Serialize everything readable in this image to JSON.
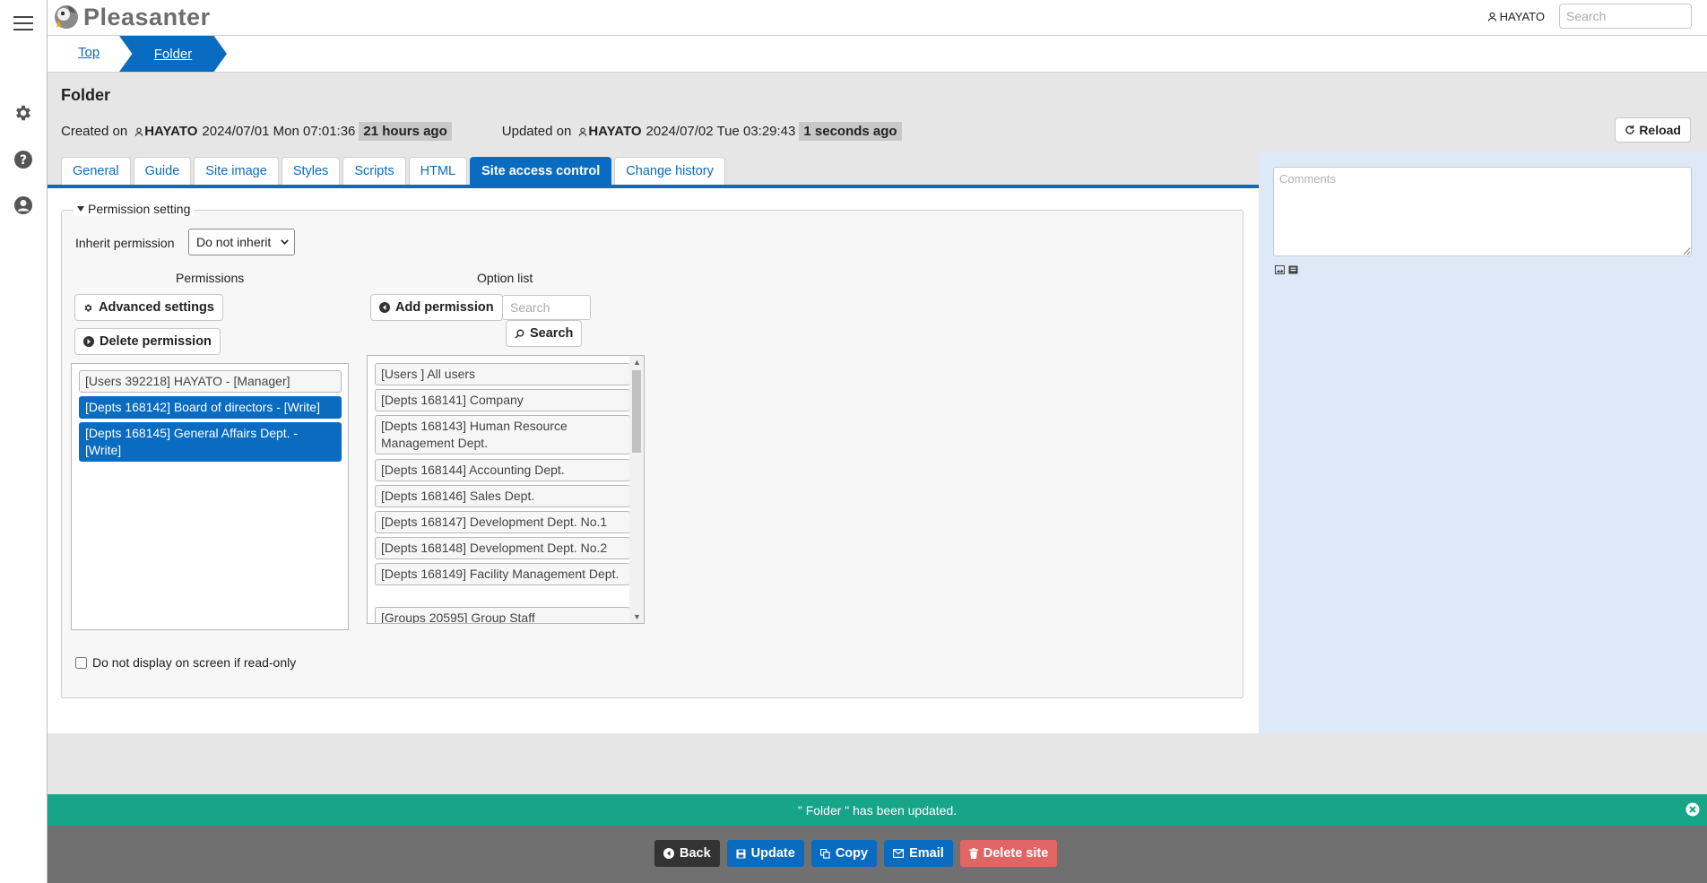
{
  "header": {
    "app_name": "Pleasanter",
    "user_name": "HAYATO",
    "search_placeholder": "Search"
  },
  "breadcrumb": {
    "items": [
      {
        "label": "Top"
      },
      {
        "label": "Folder"
      }
    ]
  },
  "page": {
    "title": "Folder",
    "created_label": "Created on",
    "created_user": "HAYATO",
    "created_datetime": "2024/07/01 Mon 07:01:36",
    "created_ago": "21 hours ago",
    "updated_label": "Updated on",
    "updated_user": "HAYATO",
    "updated_datetime": "2024/07/02 Tue 03:29:43",
    "updated_ago": "1 seconds ago",
    "reload_label": "Reload"
  },
  "tabs": [
    {
      "label": "General"
    },
    {
      "label": "Guide"
    },
    {
      "label": "Site image"
    },
    {
      "label": "Styles"
    },
    {
      "label": "Scripts"
    },
    {
      "label": "HTML"
    },
    {
      "label": "Site access control",
      "active": true
    },
    {
      "label": "Change history"
    }
  ],
  "comments": {
    "placeholder": "Comments"
  },
  "permission": {
    "legend": "Permission setting",
    "inherit_label": "Inherit permission",
    "inherit_value": "Do not inherit",
    "permissions_heading": "Permissions",
    "option_list_heading": "Option list",
    "advanced_settings_label": "Advanced settings",
    "delete_permission_label": "Delete permission",
    "add_permission_label": "Add permission",
    "search_placeholder": "Search",
    "search_button_label": "Search",
    "current": [
      {
        "text": "[Users 392218] HAYATO - [Manager]",
        "selected": false
      },
      {
        "text": "[Depts 168142] Board of directors - [Write]",
        "selected": true
      },
      {
        "text": "[Depts 168145] General Affairs Dept. - [Write]",
        "selected": true
      }
    ],
    "options": [
      {
        "text": "[Users ] All users"
      },
      {
        "text": "[Depts 168141] Company"
      },
      {
        "text": "[Depts 168143] Human Resource Management Dept."
      },
      {
        "text": "[Depts 168144] Accounting Dept."
      },
      {
        "text": "[Depts 168146] Sales Dept."
      },
      {
        "text": "[Depts 168147] Development Dept. No.1"
      },
      {
        "text": "[Depts 168148] Development Dept. No.2"
      },
      {
        "text": "[Depts 168149] Facility Management Dept."
      },
      {
        "text": "[Groups 20595] Group Staff"
      }
    ],
    "readonly_checkbox_label": "Do not display on screen if read-only"
  },
  "message": {
    "text": "\" Folder \" has been updated."
  },
  "footer": {
    "back_label": "Back",
    "update_label": "Update",
    "copy_label": "Copy",
    "email_label": "Email",
    "delete_label": "Delete site"
  },
  "colors": {
    "primary": "#0a6cc0",
    "success": "#17a589",
    "danger": "#e06666",
    "dark": "#333333"
  }
}
